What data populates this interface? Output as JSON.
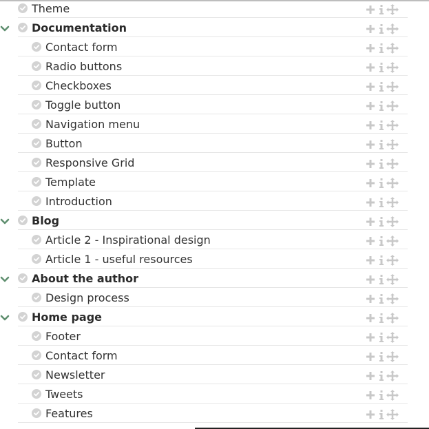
{
  "tree": {
    "items": [
      {
        "label": "Theme",
        "level": 0,
        "bold": false,
        "expanded": false
      },
      {
        "label": "Documentation",
        "level": 0,
        "bold": true,
        "expanded": true
      },
      {
        "label": "Contact form",
        "level": 1,
        "bold": false,
        "expanded": false
      },
      {
        "label": "Radio buttons",
        "level": 1,
        "bold": false,
        "expanded": false
      },
      {
        "label": "Checkboxes",
        "level": 1,
        "bold": false,
        "expanded": false
      },
      {
        "label": "Toggle button",
        "level": 1,
        "bold": false,
        "expanded": false
      },
      {
        "label": "Navigation menu",
        "level": 1,
        "bold": false,
        "expanded": false
      },
      {
        "label": "Button",
        "level": 1,
        "bold": false,
        "expanded": false
      },
      {
        "label": "Responsive Grid",
        "level": 1,
        "bold": false,
        "expanded": false
      },
      {
        "label": "Template",
        "level": 1,
        "bold": false,
        "expanded": false
      },
      {
        "label": "Introduction",
        "level": 1,
        "bold": false,
        "expanded": false
      },
      {
        "label": "Blog",
        "level": 0,
        "bold": true,
        "expanded": true
      },
      {
        "label": "Article 2 - Inspirational design",
        "level": 1,
        "bold": false,
        "expanded": false
      },
      {
        "label": "Article 1 - useful resources",
        "level": 1,
        "bold": false,
        "expanded": false
      },
      {
        "label": "About the author",
        "level": 0,
        "bold": true,
        "expanded": true
      },
      {
        "label": "Design process",
        "level": 1,
        "bold": false,
        "expanded": false
      },
      {
        "label": "Home page",
        "level": 0,
        "bold": true,
        "expanded": true
      },
      {
        "label": "Footer",
        "level": 1,
        "bold": false,
        "expanded": false
      },
      {
        "label": "Contact form",
        "level": 1,
        "bold": false,
        "expanded": false
      },
      {
        "label": "Newsletter",
        "level": 1,
        "bold": false,
        "expanded": false
      },
      {
        "label": "Tweets",
        "level": 1,
        "bold": false,
        "expanded": false
      },
      {
        "label": "Features",
        "level": 1,
        "bold": false,
        "expanded": false
      }
    ],
    "icons": {
      "status": "check-circle-icon",
      "expand": "chevron-down-icon",
      "add": "plus-icon",
      "info": "info-icon",
      "move": "move-arrows-icon"
    }
  },
  "colors": {
    "chevron": "#5f8f6f",
    "check_bg": "#d3d3d3",
    "action_icon": "#c8c8c8",
    "divider": "#e6e6e6",
    "text": "#333333"
  }
}
